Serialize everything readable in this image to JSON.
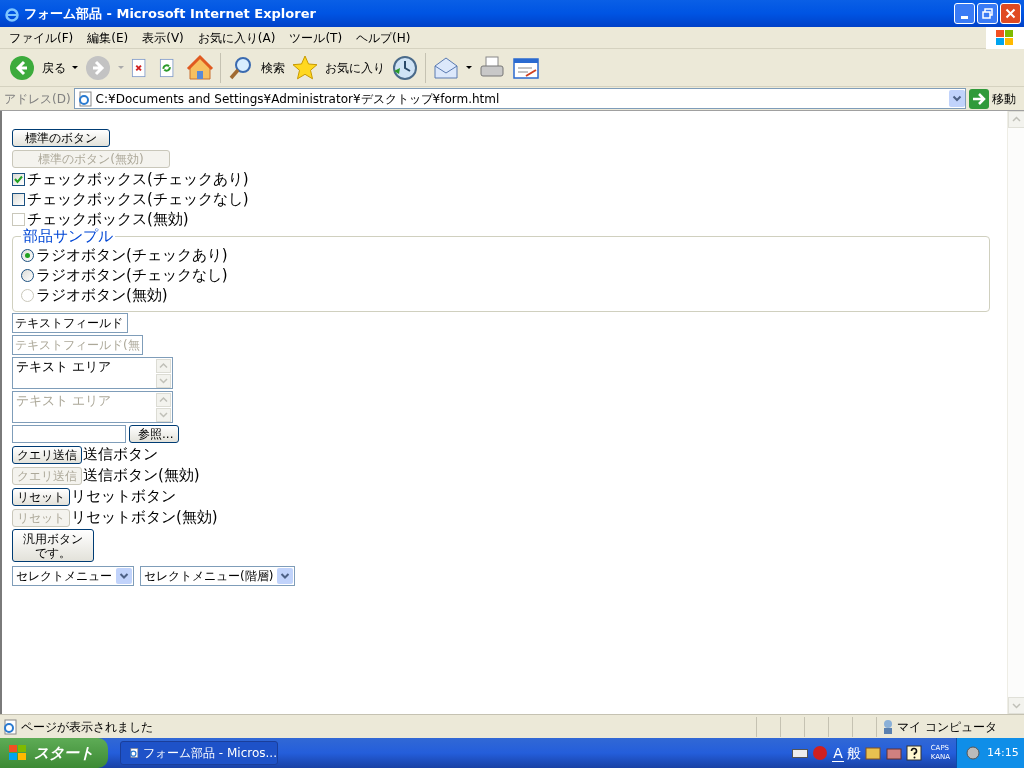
{
  "window": {
    "title": "フォーム部品 - Microsoft Internet Explorer"
  },
  "menu": [
    "ファイル(F)",
    "編集(E)",
    "表示(V)",
    "お気に入り(A)",
    "ツール(T)",
    "ヘルプ(H)"
  ],
  "toolbar": {
    "back": "戻る",
    "search": "検索",
    "favorites": "お気に入り"
  },
  "address": {
    "label": "アドレス(D)",
    "value": "C:¥Documents and Settings¥Administrator¥デスクトップ¥form.html",
    "go": "移動"
  },
  "form": [
    {
      "kind": "button",
      "label": "標準のボタン",
      "disabled": false
    },
    {
      "kind": "button",
      "label": "標準のボタン(無効)",
      "disabled": true
    },
    {
      "kind": "checkbox",
      "label": "チェックボックス(チェックあり)",
      "checked": true,
      "disabled": false
    },
    {
      "kind": "checkbox",
      "label": "チェックボックス(チェックなし)",
      "checked": false,
      "disabled": false
    },
    {
      "kind": "checkbox",
      "label": "チェックボックス(無効)",
      "checked": false,
      "disabled": true
    },
    {
      "kind": "fieldset",
      "legend": "部品サンプル",
      "radios": [
        {
          "label": "ラジオボタン(チェックあり)",
          "selected": true,
          "disabled": false
        },
        {
          "label": "ラジオボタン(チェックなし)",
          "selected": false,
          "disabled": false
        },
        {
          "label": "ラジオボタン(無効)",
          "selected": false,
          "disabled": true
        }
      ]
    },
    {
      "kind": "textfield",
      "value": "テキストフィールド",
      "disabled": false
    },
    {
      "kind": "textfield",
      "value": "テキストフィールド(無",
      "disabled": true
    },
    {
      "kind": "textarea",
      "value": "テキスト エリア",
      "disabled": false
    },
    {
      "kind": "textarea",
      "value": "テキスト エリア",
      "disabled": true
    },
    {
      "kind": "file",
      "browse": "参照..."
    },
    {
      "kind": "submit",
      "label": "クエリ送信",
      "caption": "送信ボタン",
      "disabled": false
    },
    {
      "kind": "submit",
      "label": "クエリ送信",
      "caption": "送信ボタン(無効)",
      "disabled": true
    },
    {
      "kind": "submit",
      "label": "リセット",
      "caption": "リセットボタン",
      "disabled": false
    },
    {
      "kind": "submit",
      "label": "リセット",
      "caption": "リセットボタン(無効)",
      "disabled": true
    },
    {
      "kind": "bigbutton",
      "label": "汎用ボタンです。"
    },
    {
      "kind": "selects",
      "selects": [
        "セレクトメニュー",
        "セレクトメニュー(階層)"
      ]
    }
  ],
  "status_bar": {
    "text": "ページが表示されました",
    "zone": "マイ コンピュータ"
  },
  "taskbar": {
    "start": "スタート",
    "task": "フォーム部品 - Micros...",
    "ime_mode": "A",
    "ime_kanji": "般",
    "caps": "CAPS",
    "kana": "KANA",
    "clock": "14:15"
  }
}
